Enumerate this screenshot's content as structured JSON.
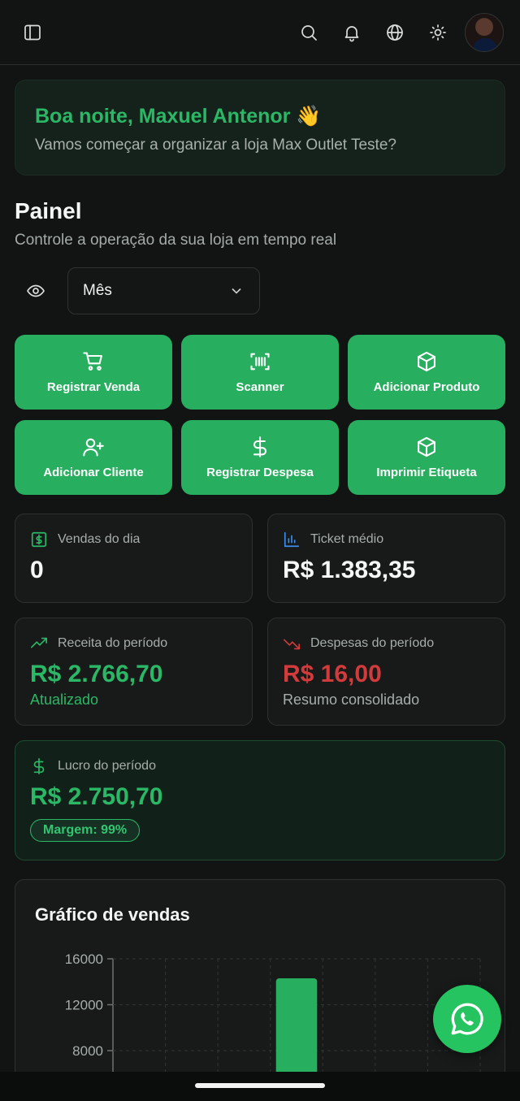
{
  "header": {
    "icons": [
      "sidebar-toggle-icon",
      "search-icon",
      "bell-icon",
      "globe-icon",
      "sun-icon"
    ]
  },
  "greeting": {
    "title": "Boa noite, Maxuel Antenor 👋",
    "subtitle": "Vamos começar a organizar a loja Max Outlet Teste?"
  },
  "panel": {
    "title": "Painel",
    "subtitle": "Controle a operação da sua loja em tempo real",
    "period_select": "Mês"
  },
  "actions": [
    {
      "label": "Registrar Venda",
      "icon": "cart-icon"
    },
    {
      "label": "Scanner",
      "icon": "scan-icon"
    },
    {
      "label": "Adicionar Produto",
      "icon": "box-icon"
    },
    {
      "label": "Adicionar Cliente",
      "icon": "user-plus-icon"
    },
    {
      "label": "Registrar Despesa",
      "icon": "dollar-icon"
    },
    {
      "label": "Imprimir Etiqueta",
      "icon": "box-icon"
    }
  ],
  "stats": {
    "sales_day": {
      "label": "Vendas do dia",
      "value": "0"
    },
    "ticket": {
      "label": "Ticket médio",
      "value": "R$ 1.383,35"
    },
    "revenue": {
      "label": "Receita do período",
      "value": "R$ 2.766,70",
      "note": "Atualizado"
    },
    "expenses": {
      "label": "Despesas do período",
      "value": "R$ 16,00",
      "note": "Resumo consolidado"
    },
    "profit": {
      "label": "Lucro do período",
      "value": "R$ 2.750,70",
      "badge": "Margem: 99%"
    }
  },
  "colors": {
    "accent": "#27ae5f",
    "negative": "#d13b3b",
    "background": "#111413"
  },
  "chart_data": {
    "type": "bar",
    "title": "Gráfico de vendas",
    "y_ticks": [
      "16000",
      "12000",
      "8000"
    ],
    "ylim": [
      0,
      16000
    ],
    "grid": true,
    "bars": [
      {
        "index": 3,
        "value": 14300
      }
    ]
  }
}
